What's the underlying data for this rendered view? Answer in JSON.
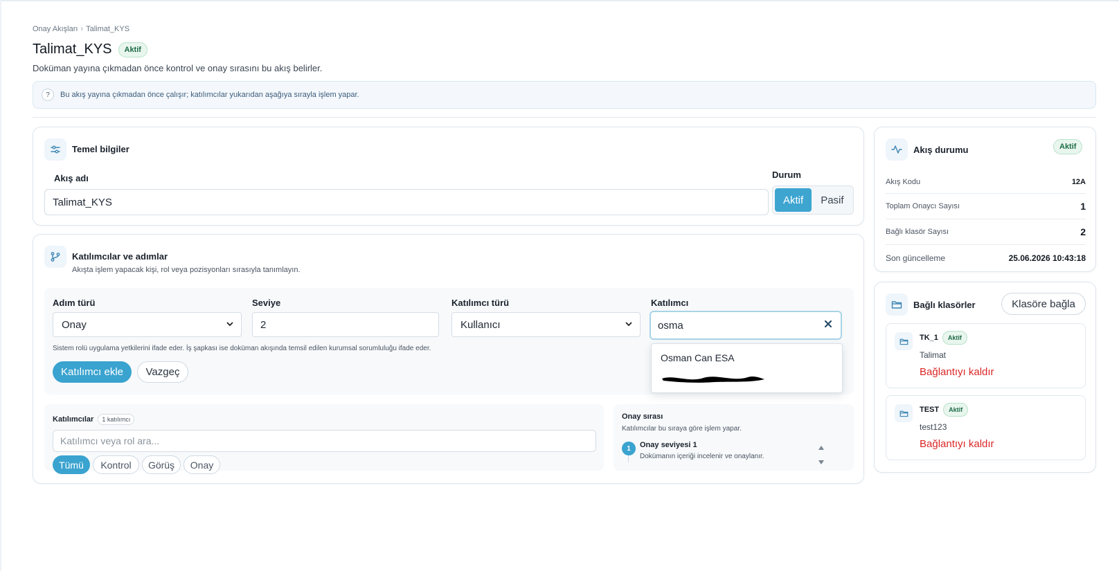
{
  "breadcrumb": {
    "parent": "Onay Akışları",
    "separator": "›",
    "current": "Talimat_KYS"
  },
  "header": {
    "title": "Talimat_KYS",
    "status_badge": "Aktif",
    "subtitle": "Doküman yayına çıkmadan önce kontrol ve onay sırasını bu akış belirler."
  },
  "info_banner": {
    "icon": "question-circle-icon",
    "text": "Bu akış yayına çıkmadan önce çalışır; katılımcılar yukarıdan aşağıya sırayla işlem yapar."
  },
  "basic_info": {
    "title": "Temel bilgiler",
    "icon": "sliders-icon",
    "flow_name_label": "Akış adı",
    "flow_name_value": "Talimat_KYS",
    "status_label": "Durum",
    "status_options": [
      "Aktif",
      "Pasif"
    ],
    "status_selected": "Aktif"
  },
  "participants": {
    "title": "Katılımcılar ve adımlar",
    "icon": "branch-icon",
    "description": "Akışta işlem yapacak kişi, rol veya pozisyonları sırasıyla tanımlayın.",
    "form": {
      "step_type_label": "Adım türü",
      "step_type_value": "Onay",
      "level_label": "Seviye",
      "level_value": "2",
      "participant_type_label": "Katılımcı türü",
      "participant_type_value": "Kullanıcı",
      "participant_label": "Katılımcı",
      "participant_value": "osma",
      "hint": "Sistem rolü uygulama yetkilerini ifade eder. İş şapkası ise doküman akışında temsil edilen kurumsal sorumluluğu ifade eder.",
      "add_button": "Katılımcı ekle",
      "cancel_button": "Vazgeç"
    },
    "dropdown": {
      "results": [
        "Osman Can ESA"
      ]
    },
    "list": {
      "title": "Katılımcılar",
      "count_badge": "1 katılımcı",
      "search_placeholder": "Katılımcı veya rol ara...",
      "filters": [
        "Tümü",
        "Kontrol",
        "Görüş",
        "Onay"
      ],
      "active_filter": "Tümü"
    },
    "order": {
      "title": "Onay sırası",
      "subtitle": "Katılımcılar bu sıraya göre işlem yapar.",
      "steps": [
        {
          "number": "1",
          "title": "Onay seviyesi 1",
          "description": "Dokümanın içeriği incelenir ve onaylanır."
        }
      ]
    }
  },
  "flow_status": {
    "title": "Akış durumu",
    "icon": "activity-icon",
    "badge": "Aktif",
    "rows": [
      {
        "key": "Akış Kodu",
        "value": "12A"
      },
      {
        "key": "Toplam Onaycı Sayısı",
        "value": "1"
      },
      {
        "key": "Bağlı klasör Sayısı",
        "value": "2"
      },
      {
        "key": "Son güncelleme",
        "value": "25.06.2026 10:43:18"
      }
    ]
  },
  "linked_folders": {
    "title": "Bağlı klasörler",
    "icon": "folder-icon",
    "link_button": "Klasöre bağla",
    "folders": [
      {
        "name": "TK_1",
        "badge": "Aktif",
        "description": "Talimat",
        "remove_label": "Bağlantıyı kaldır"
      },
      {
        "name": "TEST",
        "badge": "Aktif",
        "description": "test123",
        "remove_label": "Bağlantıyı kaldır"
      }
    ]
  },
  "colors": {
    "accent": "#3aa3cf",
    "success": "#1d6b45",
    "danger": "#dc2626",
    "border": "#dde5ec"
  }
}
